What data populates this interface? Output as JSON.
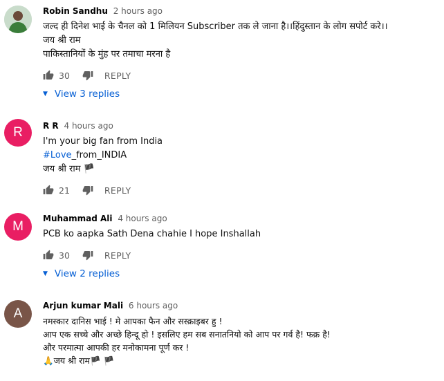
{
  "comments": [
    {
      "author": "Robin Sandhu",
      "time": "2 hours ago",
      "avatar_letter": "",
      "lines": [
        "जल्द ही दिनेश भाई के चैनल को 1 मिलियन Subscriber तक ले जाना है।।हिंदुस्तान के लोग सपोर्ट करे।।",
        "जय श्री राम",
        "पाकिस्तानियों के मुंह पर तमाचा मरना है"
      ],
      "likes": "30",
      "reply_label": "REPLY",
      "view_replies": "View 3 replies"
    },
    {
      "author": "R R",
      "time": "4 hours ago",
      "avatar_letter": "R",
      "avatar_color": "#e91e63",
      "lines": [
        "I'm your big fan from India",
        "#Love",
        "_from_INDIA",
        "जय श्री राम 🏴"
      ],
      "likes": "21",
      "reply_label": "REPLY"
    },
    {
      "author": "Muhammad Ali",
      "time": "4 hours ago",
      "avatar_letter": "M",
      "avatar_color": "#e91e63",
      "lines": [
        "PCB ko aapka Sath Dena chahie I hope Inshallah"
      ],
      "likes": "30",
      "reply_label": "REPLY",
      "view_replies": "View 2 replies"
    },
    {
      "author": "Arjun kumar Mali",
      "time": "6 hours ago",
      "avatar_letter": "A",
      "avatar_color": "#795548",
      "lines": [
        "नमस्कार दानिस भाई ! मे आपका फैन और सस्क्राइबर हु !",
        "आप एक सच्चे और अच्छे हिन्दू हो ! इसलिए हम सब सनातनियो को आप पर गर्व है! फक्र है!",
        "और परमात्मा आपकी हर मनोकामना पूर्ण कर !",
        "🙏जय श्री राम🏴 🏴"
      ]
    }
  ],
  "colors": {
    "link": "#065fd4",
    "meta": "#606060",
    "avatar_pink": "#e91e63",
    "avatar_brown": "#795548"
  }
}
